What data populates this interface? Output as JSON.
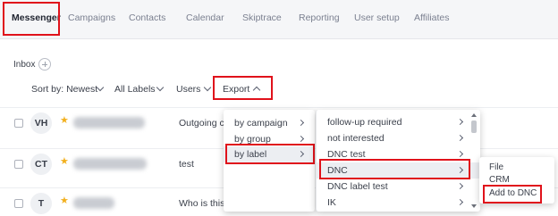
{
  "nav": {
    "tabs": [
      "Messenger",
      "Campaigns",
      "Contacts",
      "Calendar",
      "Skiptrace",
      "Reporting",
      "User setup",
      "Affiliates"
    ],
    "active": "Messenger"
  },
  "inbox": {
    "label": "Inbox"
  },
  "filters": {
    "sort": "Sort by: Newest",
    "labels": "All Labels",
    "users": "Users",
    "export": "Export"
  },
  "rows": [
    {
      "initials": "VH",
      "preview": "Outgoing cal"
    },
    {
      "initials": "CT",
      "preview": "test"
    },
    {
      "initials": "T",
      "preview": "Who is this?"
    }
  ],
  "menu1": {
    "items": [
      "by campaign",
      "by group",
      "by label"
    ],
    "selected": "by label"
  },
  "menu2": {
    "items": [
      "follow-up required",
      "not interested",
      "DNC test",
      "",
      "DNC",
      "DNC label test",
      "IK"
    ],
    "selected": "DNC"
  },
  "menu3": {
    "items": [
      "File",
      "CRM",
      "Add to DNC"
    ],
    "highlighted": "Add to DNC"
  },
  "colors": {
    "highlight": "#e0121b",
    "star": "#f2b01e"
  }
}
